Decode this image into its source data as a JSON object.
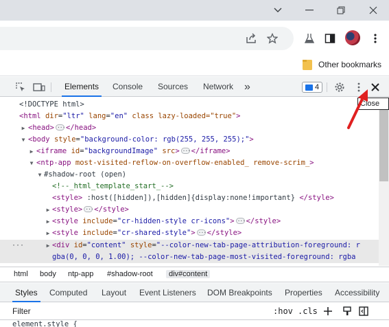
{
  "window": {
    "minimize_glyph": "–",
    "maximize_glyph": "❐",
    "close_glyph": "✕"
  },
  "bookmarks_bar": {
    "other_bookmarks": "Other bookmarks"
  },
  "devtools": {
    "tabs": [
      "Elements",
      "Console",
      "Sources",
      "Network"
    ],
    "more_tabs": "»",
    "issues_count": "4",
    "tooltip": "Close",
    "elements_tree": {
      "doctype": "<!DOCTYPE html>",
      "html_open": "<html",
      "html_attrs": [
        {
          "name": "dir",
          "value": "\"ltr\""
        },
        {
          "name": "lang",
          "value": "\"en\""
        },
        {
          "name": "class",
          "value": "lazy-loaded=\"true\""
        }
      ],
      "head": "<head>",
      "head_close": "</head>",
      "body_open": "<body",
      "body_attr_name": "style",
      "body_attr_value": "\"background-color: rgb(255, 255, 255);\"",
      "iframe_open": "<iframe",
      "iframe_id_name": "id",
      "iframe_id_value": "\"backgroundImage\"",
      "iframe_src": "src",
      "iframe_close": "</iframe>",
      "ntp_open": "<ntp-app",
      "ntp_attrs": "most-visited-reflow-on-overflow-enabled_ remove-scrim_",
      "shadow_root": "#shadow-root (open)",
      "comment": "<!--_html_template_start_-->",
      "style1_open": "<style>",
      "style1_text": " :host([hidden]),[hidden]{display:none!important} ",
      "style1_close": "</style>",
      "style2_open": "<style>",
      "style2_close": "</style>",
      "style3_open": "<style",
      "style3_attr": "include",
      "style3_val": "\"cr-hidden-style cr-icons\"",
      "style3_close": "</style>",
      "style4_open": "<style",
      "style4_attr": "include",
      "style4_val": "\"cr-shared-style\"",
      "style4_close": "</style>",
      "gutter_dots": "···",
      "div_open": "<div",
      "div_id_name": "id",
      "div_id_value": "\"content\"",
      "div_style_name": "style",
      "div_style_value_1": "\"--color-new-tab-page-attribution-foreground: r",
      "div_style_value_2": "gba(0, 0, 0, 1.00); --color-new-tab-page-most-visited-foreground: rgba"
    },
    "breadcrumbs": [
      "html",
      "body",
      "ntp-app",
      "#shadow-root",
      "div#content"
    ],
    "styles_tabs": [
      "Styles",
      "Computed",
      "Layout",
      "Event Listeners",
      "DOM Breakpoints",
      "Properties",
      "Accessibility"
    ],
    "filter_placeholder": "Filter",
    "hov": ":hov",
    "cls": ".cls",
    "element_style": "element.style {"
  }
}
